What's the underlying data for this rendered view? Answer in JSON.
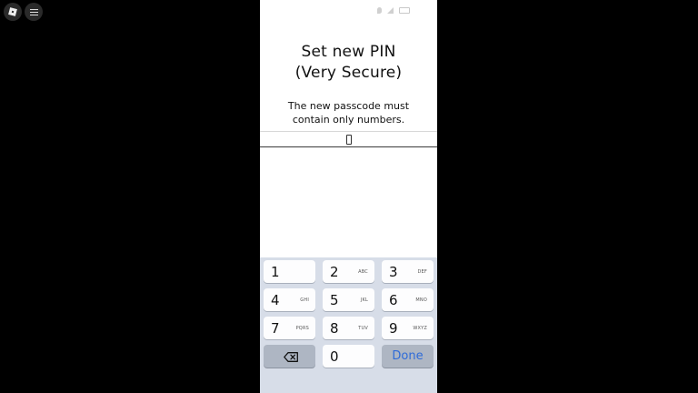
{
  "overlay": {
    "logo_icon": "app-logo-icon",
    "menu_icon": "hamburger-menu-icon"
  },
  "status_bar": {
    "icons": [
      "location-icon",
      "signal-icon",
      "battery-icon"
    ]
  },
  "screen": {
    "title_line1": "Set new PIN",
    "title_line2": "(Very Secure)",
    "subtitle_line1": "The new passcode must",
    "subtitle_line2": "contain only numbers.",
    "input_value": "",
    "input_placeholder": ""
  },
  "keyboard": {
    "keys": [
      {
        "num": "1",
        "letters": ""
      },
      {
        "num": "2",
        "letters": "ABC"
      },
      {
        "num": "3",
        "letters": "DEF"
      },
      {
        "num": "4",
        "letters": "GHI"
      },
      {
        "num": "5",
        "letters": "JKL"
      },
      {
        "num": "6",
        "letters": "MNO"
      },
      {
        "num": "7",
        "letters": "PQRS"
      },
      {
        "num": "8",
        "letters": "TUV"
      },
      {
        "num": "9",
        "letters": "WXYZ"
      }
    ],
    "zero": "0",
    "done_label": "Done",
    "delete_icon": "backspace-icon"
  },
  "colors": {
    "keyboard_bg": "#d7dde8",
    "done_text": "#2f6bd8"
  }
}
